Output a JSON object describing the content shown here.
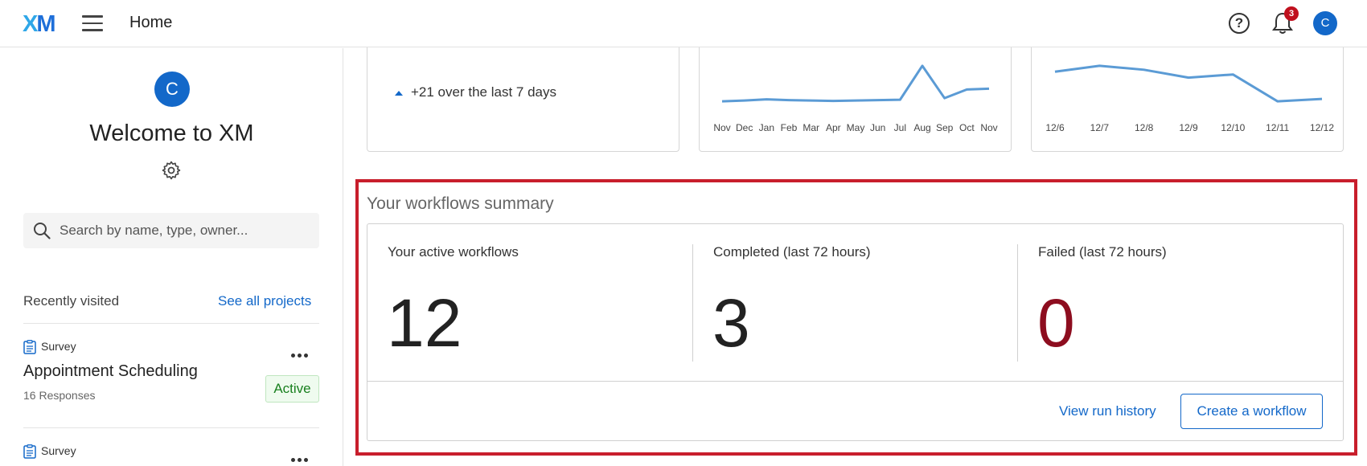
{
  "header": {
    "logo": {
      "a": "X",
      "b": "M"
    },
    "title": "Home",
    "notifications_count": "3",
    "avatar_initial": "C",
    "help_glyph": "?"
  },
  "sidebar": {
    "avatar_initial": "C",
    "welcome": "Welcome to XM",
    "search_placeholder": "Search by name, type, owner...",
    "recently_visited": "Recently visited",
    "see_all": "See all projects",
    "items": [
      {
        "type": "Survey",
        "title": "Appointment Scheduling",
        "responses": "16 Responses",
        "status": "Active"
      },
      {
        "type": "Survey"
      }
    ]
  },
  "cards": {
    "card1": {
      "trend": "+21 over the last 7 days"
    }
  },
  "chart_data": [
    {
      "type": "line",
      "categories": [
        "Nov",
        "Dec",
        "Jan",
        "Feb",
        "Mar",
        "Apr",
        "May",
        "Jun",
        "Jul",
        "Aug",
        "Sep",
        "Oct",
        "Nov"
      ],
      "values": [
        1,
        1.2,
        1.5,
        1.3,
        1.2,
        1.1,
        1.2,
        1.3,
        1.4,
        10,
        1.8,
        4,
        4.2
      ],
      "ylim": [
        0,
        11
      ],
      "color": "#5b9bd5"
    },
    {
      "type": "line",
      "categories": [
        "12/6",
        "12/7",
        "12/8",
        "12/9",
        "12/10",
        "12/11",
        "12/12"
      ],
      "values": [
        8.5,
        10,
        9,
        7,
        7.8,
        1,
        1.6
      ],
      "ylim": [
        0,
        11
      ],
      "color": "#5b9bd5"
    }
  ],
  "workflows": {
    "title": "Your workflows summary",
    "active_label": "Your active workflows",
    "active_value": "12",
    "completed_label": "Completed (last 72 hours)",
    "completed_value": "3",
    "failed_label": "Failed (last 72 hours)",
    "failed_value": "0",
    "view_history": "View run history",
    "create": "Create a workflow"
  },
  "colors": {
    "accent": "#1368c9",
    "highlight": "#c81e2c",
    "failed": "#8d0d1f",
    "active_green": "#19801f"
  }
}
